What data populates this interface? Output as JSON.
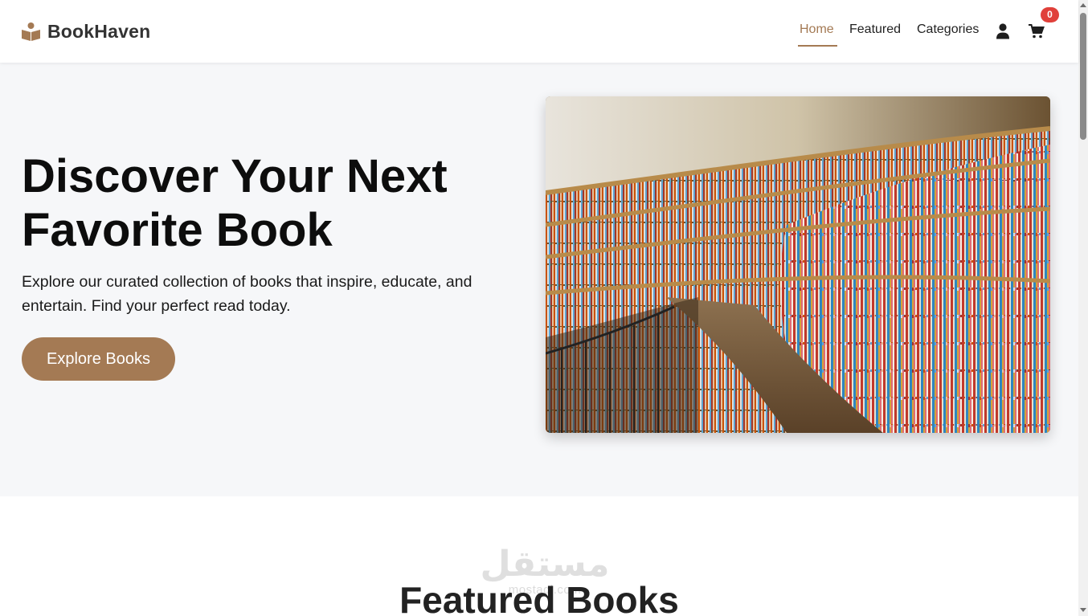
{
  "brand": {
    "name": "BookHaven",
    "logo_icon": "book-reader-icon",
    "accent_color": "#a47a54"
  },
  "nav": {
    "home": "Home",
    "featured": "Featured",
    "categories": "Categories"
  },
  "actions": {
    "user_icon": "user-icon",
    "cart_icon": "cart-icon",
    "cart_count": "0",
    "badge_color": "#e0403a"
  },
  "hero": {
    "title_line1": "Discover Your Next",
    "title_line2": "Favorite Book",
    "subtitle": "Explore our curated collection of books that inspire, educate, and entertain. Find your perfect read today.",
    "button_label": "Explore Books",
    "image_subject": "curved library bookshelves photo"
  },
  "featured": {
    "title": "Featured Books"
  },
  "watermark": {
    "arabic": "مستقل",
    "latin": "mostaql.com"
  }
}
